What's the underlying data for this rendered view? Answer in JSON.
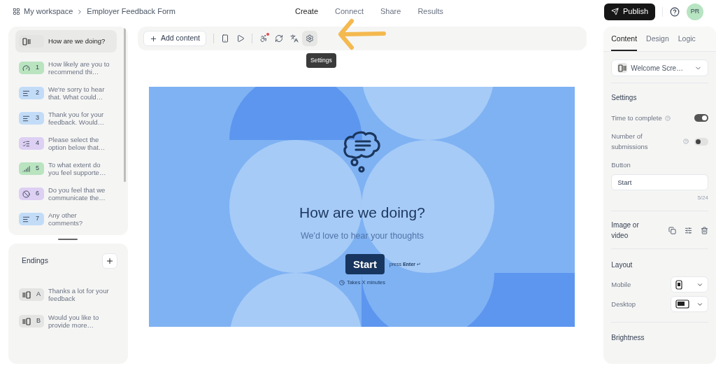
{
  "breadcrumb": {
    "workspace": "My workspace",
    "form": "Employer Feedback Form"
  },
  "nav": [
    {
      "label": "Create",
      "selected": true
    },
    {
      "label": "Connect",
      "selected": false
    },
    {
      "label": "Share",
      "selected": false
    },
    {
      "label": "Results",
      "selected": false
    }
  ],
  "publish": "Publish",
  "avatar": "PR",
  "toolbar": {
    "add": "Add content",
    "tooltip": "Settings"
  },
  "questions": [
    {
      "kind": "welcome",
      "text": "How are we doing?",
      "selected": true
    },
    {
      "kind": "rating",
      "number": "1",
      "text": "How likely are you to recommend thi…",
      "selected": false
    },
    {
      "kind": "text",
      "number": "2",
      "text": "We're sorry to hear that. What could…",
      "selected": false
    },
    {
      "kind": "text",
      "number": "3",
      "text": "Thank you for your feedback. Would…",
      "selected": false
    },
    {
      "kind": "choice",
      "number": "4",
      "text": "Please select the option below that…",
      "selected": false
    },
    {
      "kind": "scale",
      "number": "5",
      "text": "To what extent do you feel supporte…",
      "selected": false
    },
    {
      "kind": "yesno",
      "number": "6",
      "text": "Do you feel that we communicate the…",
      "selected": false
    },
    {
      "kind": "text",
      "number": "7",
      "text": "Any other comments?",
      "selected": false
    }
  ],
  "endings": {
    "title": "Endings",
    "items": [
      {
        "letter": "A",
        "text": "Thanks a lot for your feedback"
      },
      {
        "letter": "B",
        "text": "Would you like to provide more…"
      }
    ]
  },
  "screen": {
    "title": "How are we doing?",
    "subtitle": "We'd love to hear your thoughts",
    "button": "Start",
    "hint": "press **Enter** ↵",
    "duration": "Takes X minutes"
  },
  "panel": {
    "tabs": [
      {
        "label": "Content",
        "selected": true
      },
      {
        "label": "Design",
        "selected": false
      },
      {
        "label": "Logic",
        "selected": false
      }
    ],
    "screen_type": "Welcome Scre…",
    "settings_title": "Settings",
    "toggles": [
      {
        "label": "Time to complete",
        "on": true
      },
      {
        "label": "Number of submissions",
        "on": false
      }
    ],
    "button_label": "Button",
    "button_value": "Start",
    "counter": "5/24",
    "media_label": "Image or video",
    "layout_title": "Layout",
    "layouts": [
      {
        "label": "Mobile",
        "kind": "mobile"
      },
      {
        "label": "Desktop",
        "kind": "desktop"
      }
    ],
    "brightness": "Brightness"
  }
}
